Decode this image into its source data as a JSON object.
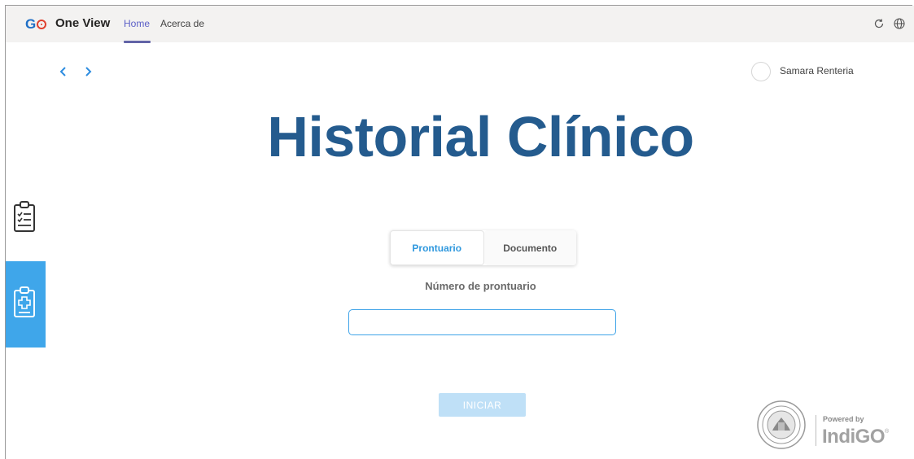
{
  "header": {
    "logo_text": "GO",
    "app_name": "One View",
    "nav": {
      "home": "Home",
      "about": "Acerca de"
    },
    "active_tab": "Home",
    "accent_color": "#6264a7"
  },
  "rail": {
    "items": [
      {
        "icon": "clipboard-checklist-icon",
        "active": false
      },
      {
        "icon": "clipboard-medical-icon",
        "active": true
      }
    ],
    "active_color": "#3fa6ea"
  },
  "user": {
    "name": "Samara Renteria"
  },
  "main": {
    "title": "Historial Clínico",
    "title_color": "#245b8e",
    "tabs": [
      {
        "label": "Prontuario",
        "selected": true
      },
      {
        "label": "Documento",
        "selected": false
      }
    ],
    "field_label": "Número de prontuario",
    "field_value": "",
    "start_button": "INICIAR"
  },
  "footer": {
    "powered_by": "Powered by",
    "brand": "IndiGO",
    "trademark": "®"
  }
}
